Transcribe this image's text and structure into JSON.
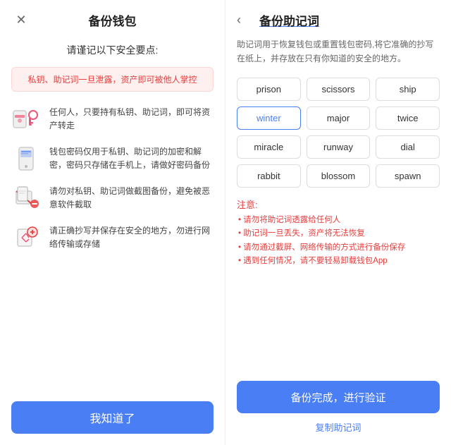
{
  "left": {
    "close_icon": "✕",
    "title": "备份钱包",
    "subtitle": "请谨记以下安全要点:",
    "warning": "私钥、助记词一旦泄露，资产即可被他人掌控",
    "items": [
      {
        "id": "key",
        "text": "任何人，只要持有私钥、助记词，即可将资产转走"
      },
      {
        "id": "phone",
        "text": "钱包密码仅用于私钥、助记词的加密和解密，密码只存储在手机上，请做好密码备份"
      },
      {
        "id": "screenshot",
        "text": "请勿对私钥、助记词做截图备份，避免被恶意软件截取"
      },
      {
        "id": "safe",
        "text": "请正确抄写并保存在安全的地方，勿进行网络传输或存储"
      }
    ],
    "confirm_label": "我知道了"
  },
  "right": {
    "back_icon": "‹",
    "title": "备份助记词",
    "description": "助记词用于恢复钱包或重置钱包密码,将它准确的抄写在纸上，并存放在只有你知道的安全的地方。",
    "words": [
      "prison",
      "scissors",
      "ship",
      "winter",
      "major",
      "twice",
      "miracle",
      "runway",
      "dial",
      "rabbit",
      "blossom",
      "spawn"
    ],
    "highlighted_word": "winter",
    "notes_title": "注意:",
    "notes": [
      "• 请勿将助记词透露给任何人",
      "• 助记词一旦丢失，资产将无法恢复",
      "• 请勿通过截屏、网络传输的方式进行备份保存",
      "• 遇到任何情况，请不要轻易卸载钱包App"
    ],
    "verify_label": "备份完成，进行验证",
    "copy_label": "复制助记词"
  }
}
